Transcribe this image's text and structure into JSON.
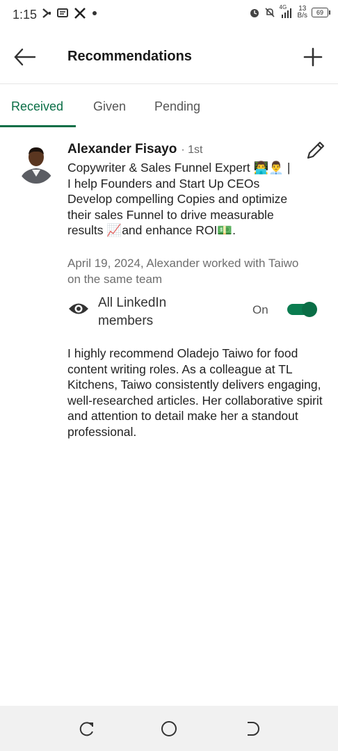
{
  "status_bar": {
    "time": "1:15",
    "network_speed_value": "13",
    "network_speed_unit": "B/s",
    "signal_label": "4G",
    "battery_level": "69"
  },
  "app_bar": {
    "title": "Recommendations"
  },
  "tabs": [
    {
      "label": "Received",
      "active": true
    },
    {
      "label": "Given",
      "active": false
    },
    {
      "label": "Pending",
      "active": false
    }
  ],
  "recommendation": {
    "name": "Alexander Fisayo",
    "degree": "· 1st",
    "headline": "Copywriter & Sales Funnel Expert 👨‍💻👨‍💼 | I help Founders and Start Up CEOs Develop compelling Copies and optimize their sales Funnel to drive measurable results 📈and enhance ROI💵.",
    "meta": "April 19, 2024, Alexander worked with Taiwo on the same team",
    "visibility_label": "All LinkedIn members",
    "visibility_state": "On",
    "text": "I highly recommend Oladejo Taiwo for food content writing roles. As a colleague at TL Kitchens, Taiwo consistently delivers engaging, well-researched articles. Her collaborative spirit and attention to detail make her a standout professional."
  },
  "colors": {
    "accent": "#0a6e46",
    "toggle_on": "#0a7c50"
  },
  "icons": [
    "back-arrow-icon",
    "plus-icon",
    "pencil-icon",
    "eye-icon",
    "recents-icon",
    "home-icon",
    "back-nav-icon"
  ]
}
